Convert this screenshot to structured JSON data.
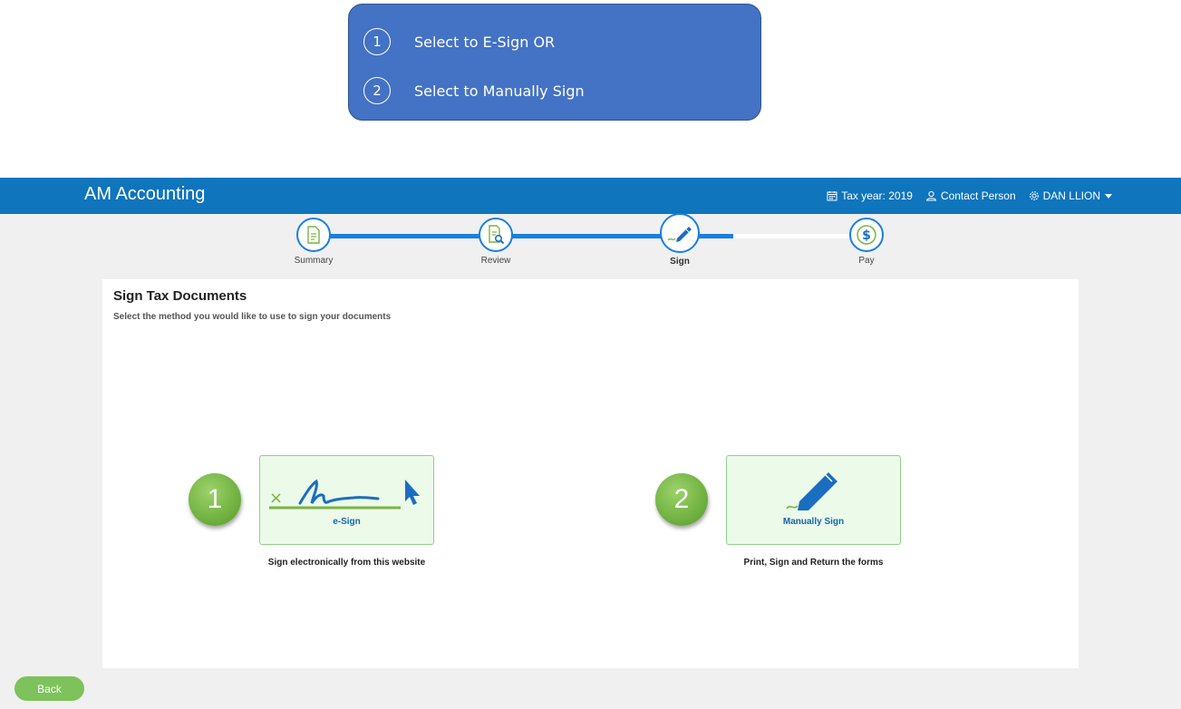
{
  "callout": {
    "items": [
      {
        "num": "1",
        "text": "Select to E-Sign OR"
      },
      {
        "num": "2",
        "text": "Select to Manually Sign"
      }
    ]
  },
  "header": {
    "brand": "AM Accounting",
    "tax_year": "Tax year: 2019",
    "contact": "Contact Person",
    "user": "DAN LLION",
    "icons": {
      "tax_year": "calendar-icon",
      "contact": "person-icon",
      "user": "gear-icon",
      "dropdown": "caret-down-icon"
    }
  },
  "steps": [
    {
      "label": "Summary",
      "icon": "document-icon",
      "active": false
    },
    {
      "label": "Review",
      "icon": "document-search-icon",
      "active": false
    },
    {
      "label": "Sign",
      "icon": "pen-icon",
      "active": true
    },
    {
      "label": "Pay",
      "icon": "dollar-icon",
      "active": false
    }
  ],
  "main": {
    "title": "Sign Tax Documents",
    "subtitle": "Select the method you would like to use to sign your documents",
    "options": [
      {
        "badge": "1",
        "label": "e-Sign",
        "description": "Sign electronically from this website",
        "icon": "signature-cursor-icon"
      },
      {
        "badge": "2",
        "label": "Manually Sign",
        "description": "Print, Sign and Return the forms",
        "icon": "pen-icon"
      }
    ]
  },
  "footer": {
    "back_label": "Back"
  },
  "colors": {
    "topbar": "#0f75bc",
    "accent": "#1a7fe0",
    "callout": "#4472c4",
    "green": "#7dc25a",
    "card_bg": "#ecfaea"
  }
}
